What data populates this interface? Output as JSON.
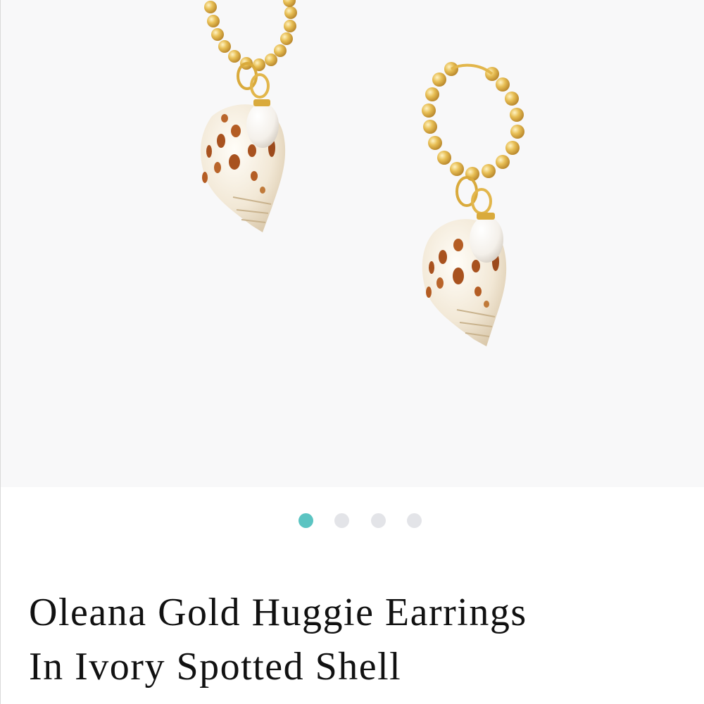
{
  "product": {
    "title_line1": "Oleana Gold Huggie Earrings",
    "title_line2": "In Ivory Spotted Shell",
    "image_alt": "Oleana Gold Huggie Earrings In Ivory Spotted Shell"
  },
  "gallery": {
    "slide_count": 4,
    "active_slide": 1,
    "dots": [
      {
        "label": "Slide 1"
      },
      {
        "label": "Slide 2"
      },
      {
        "label": "Slide 3"
      },
      {
        "label": "Slide 4"
      }
    ]
  },
  "colors": {
    "gallery_bg": "#f8f8f9",
    "dot_active": "#5bc4c2",
    "dot_inactive": "#e3e4e8",
    "gold": "#e0b548",
    "shell_ivory": "#f3ebdc",
    "shell_spot": "#a8521f"
  }
}
